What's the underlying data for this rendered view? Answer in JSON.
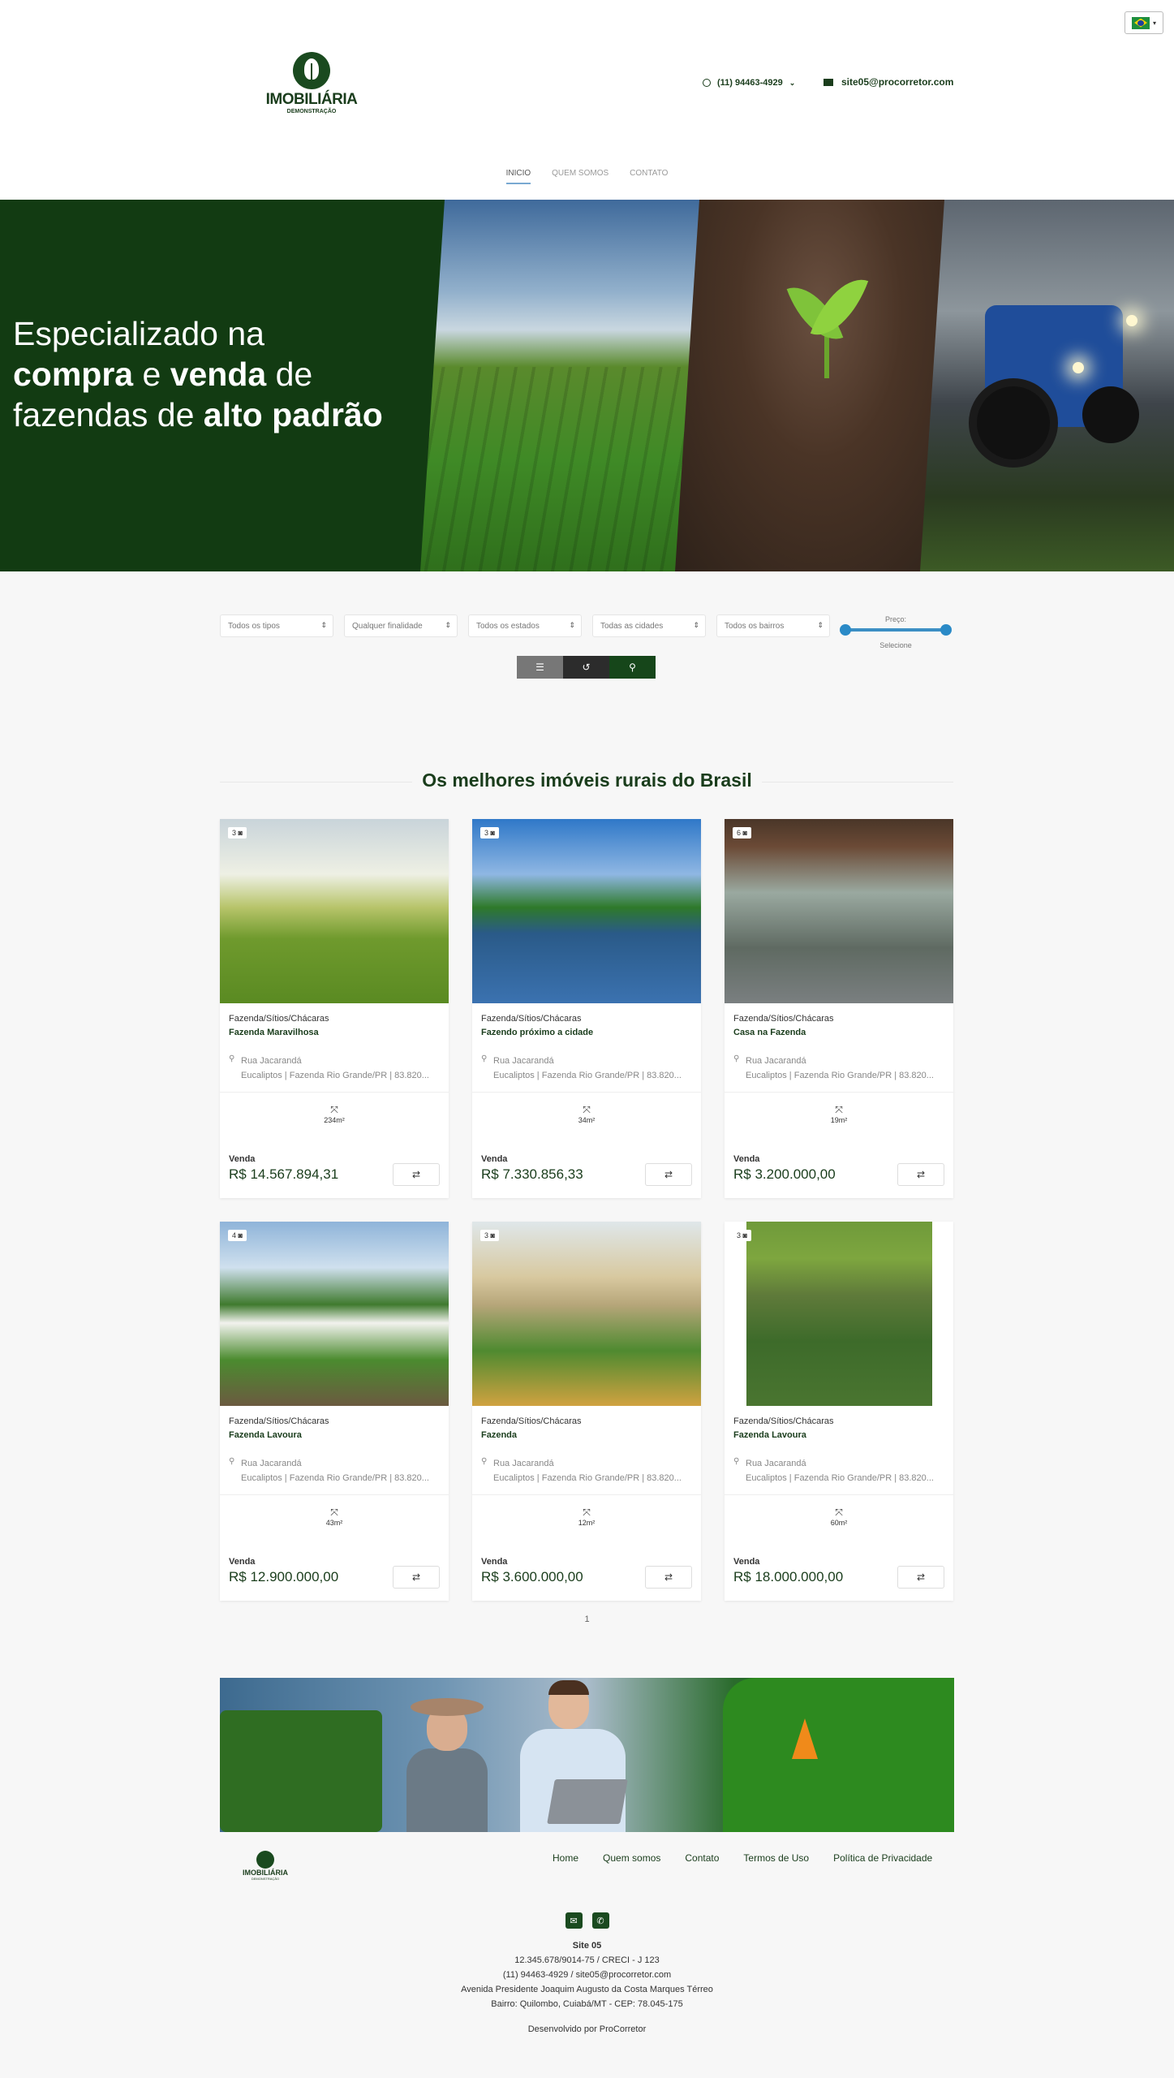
{
  "header": {
    "logo_title": "IMOBILIÁRIA",
    "logo_subtitle": "DEMONSTRAÇÃO",
    "phone": "(11) 94463-4929",
    "email": "site05@procorretor.com",
    "language": "pt-BR flag"
  },
  "nav": {
    "items": [
      {
        "label": "INICIO",
        "active": true
      },
      {
        "label": "QUEM SOMOS",
        "active": false
      },
      {
        "label": "CONTATO",
        "active": false
      }
    ]
  },
  "hero": {
    "line1": "Especializado na",
    "line2_a": "compra",
    "line2_b": " e ",
    "line2_c": "venda",
    "line2_d": " de",
    "line3_a": "fazendas de ",
    "line3_b": "alto padrão"
  },
  "search": {
    "tipo": "Todos os tipos",
    "finalidade": "Qualquer finalidade",
    "estado": "Todos os estados",
    "cidade": "Todas as cidades",
    "bairro": "Todos os bairros",
    "price_label": "Preço:",
    "price_sub": "Selecione"
  },
  "listing": {
    "title": "Os melhores imóveis rurais do Brasil",
    "cards": [
      {
        "photos": "3",
        "category": "Fazenda/Sítios/Chácaras",
        "title": "Fazenda Maravilhosa",
        "street": "Rua Jacarandá",
        "address": "Eucaliptos | Fazenda Rio Grande/PR | 83.820...",
        "area": "234m²",
        "negocio": "Venda",
        "price": "R$ 14.567.894,31"
      },
      {
        "photos": "3",
        "category": "Fazenda/Sítios/Chácaras",
        "title": "Fazendo próximo a cidade",
        "street": "Rua Jacarandá",
        "address": "Eucaliptos | Fazenda Rio Grande/PR | 83.820...",
        "area": "34m²",
        "negocio": "Venda",
        "price": "R$ 7.330.856,33"
      },
      {
        "photos": "6",
        "category": "Fazenda/Sítios/Chácaras",
        "title": "Casa na Fazenda",
        "street": "Rua Jacarandá",
        "address": "Eucaliptos | Fazenda Rio Grande/PR | 83.820...",
        "area": "19m²",
        "negocio": "Venda",
        "price": "R$ 3.200.000,00"
      },
      {
        "photos": "4",
        "category": "Fazenda/Sítios/Chácaras",
        "title": "Fazenda Lavoura",
        "street": "Rua Jacarandá",
        "address": "Eucaliptos | Fazenda Rio Grande/PR | 83.820...",
        "area": "43m²",
        "negocio": "Venda",
        "price": "R$ 12.900.000,00"
      },
      {
        "photos": "3",
        "category": "Fazenda/Sítios/Chácaras",
        "title": "Fazenda",
        "street": "Rua Jacarandá",
        "address": "Eucaliptos | Fazenda Rio Grande/PR | 83.820...",
        "area": "12m²",
        "negocio": "Venda",
        "price": "R$ 3.600.000,00"
      },
      {
        "photos": "3",
        "category": "Fazenda/Sítios/Chácaras",
        "title": "Fazenda Lavoura",
        "street": "Rua Jacarandá",
        "address": "Eucaliptos | Fazenda Rio Grande/PR | 83.820...",
        "area": "60m²",
        "negocio": "Venda",
        "price": "R$ 18.000.000,00"
      }
    ],
    "page": "1"
  },
  "footer": {
    "logo_title": "IMOBILIÁRIA",
    "logo_subtitle": "DEMONSTRAÇÃO",
    "links": [
      "Home",
      "Quem somos",
      "Contato",
      "Termos de Uso",
      "Política de Privacidade"
    ],
    "site_name": "Site 05",
    "cnpj": "12.345.678/9014-75 / CRECI - J 123",
    "contact": "(11) 94463-4929 / site05@procorretor.com",
    "address1": "Avenida Presidente Joaquim Augusto da Costa Marques Térreo",
    "address2": "Bairro: Quilombo, Cuiabá/MT - CEP: 78.045-175",
    "developed": "Desenvolvido por ProCorretor"
  },
  "colors": {
    "brand": "#1a3d1c",
    "hero_bg": "#123b12",
    "accent_blue": "#2a8ac7"
  }
}
